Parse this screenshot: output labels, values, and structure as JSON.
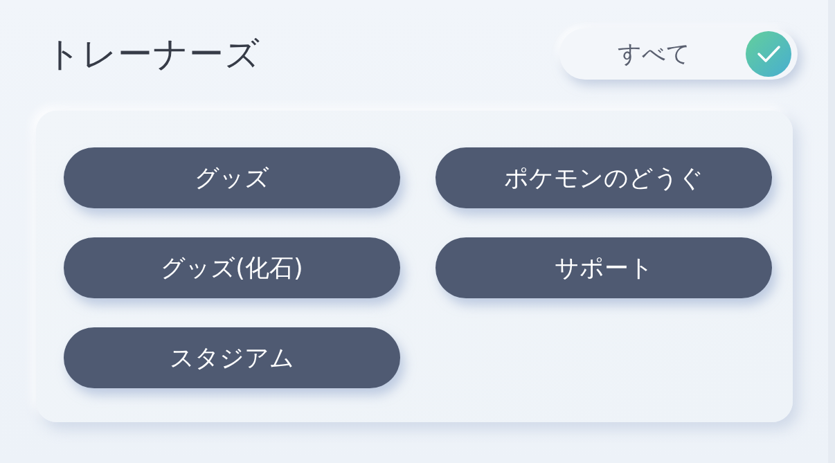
{
  "title": "トレーナーズ",
  "all_toggle": {
    "label": "すべて",
    "checked": true
  },
  "categories": [
    {
      "label": "グッズ"
    },
    {
      "label": "ポケモンのどうぐ"
    },
    {
      "label": "グッズ(化石)"
    },
    {
      "label": "サポート"
    },
    {
      "label": "スタジアム"
    }
  ]
}
